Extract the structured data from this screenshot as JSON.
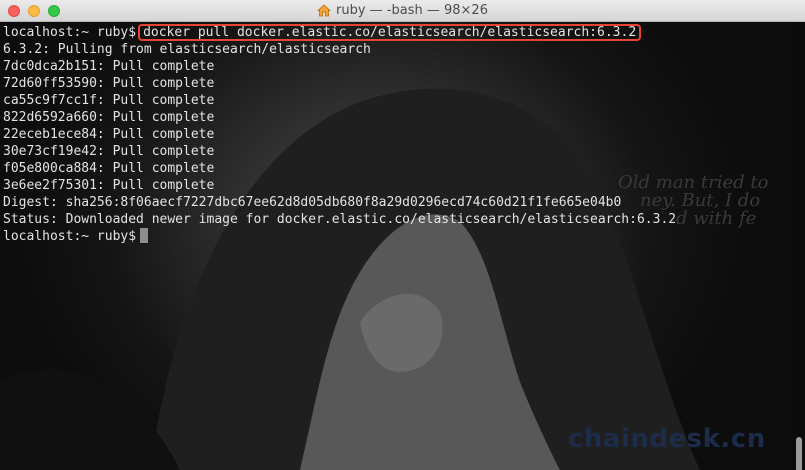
{
  "window": {
    "title": "ruby — -bash — 98×26"
  },
  "terminal": {
    "prompt_1": "localhost:~ ruby$",
    "command": "docker pull docker.elastic.co/elasticsearch/elasticsearch:6.3.2",
    "output": [
      "6.3.2: Pulling from elasticsearch/elasticsearch",
      "7dc0dca2b151: Pull complete",
      "72d60ff53590: Pull complete",
      "ca55c9f7cc1f: Pull complete",
      "822d6592a660: Pull complete",
      "22eceb1ece84: Pull complete",
      "30e73cf19e42: Pull complete",
      "f05e800ca884: Pull complete",
      "3e6ee2f75301: Pull complete",
      "Digest: sha256:8f06aecf7227dbc67ee62d8d05db680f8a29d0296ecd74c60d21f1fe665e04b0",
      "Status: Downloaded newer image for docker.elastic.co/elasticsearch/elasticsearch:6.3.2"
    ],
    "prompt_2": "localhost:~ ruby$"
  },
  "wallpaper_text": {
    "line1": "Old man tried to",
    "line2": "ney. But, I do",
    "line3": "d with fe"
  },
  "watermark": "chaindesk.cn",
  "colors": {
    "highlight": "#e8442f",
    "text": "#e3e3e3"
  }
}
